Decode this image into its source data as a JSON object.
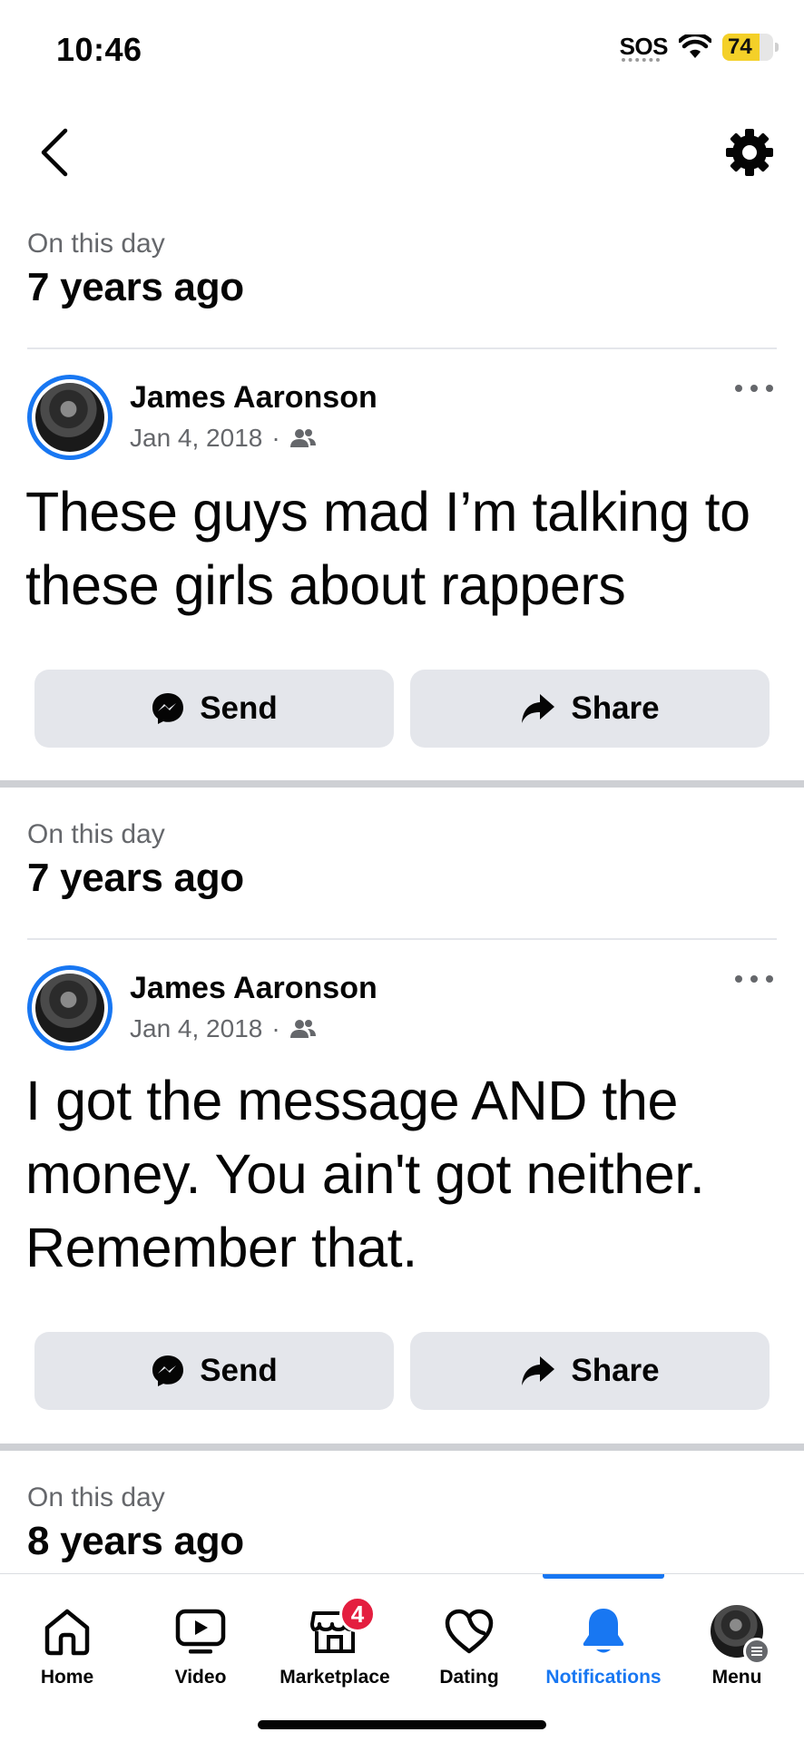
{
  "status_bar": {
    "time": "10:46",
    "sos": "SOS",
    "battery": "74",
    "battery_level": 0.74
  },
  "nav": {
    "back_icon": "chevron-left-icon",
    "settings_icon": "gear-icon"
  },
  "memories": [
    {
      "kicker": "On this day",
      "years": "7 years ago",
      "author": "James Aaronson",
      "date": "Jan 4, 2018",
      "separator": "·",
      "audience_icon": "friends-icon",
      "text": "These guys mad I’m talking to these girls about rappers",
      "send_label": "Send",
      "share_label": "Share"
    },
    {
      "kicker": "On this day",
      "years": "7 years ago",
      "author": "James Aaronson",
      "date": "Jan 4, 2018",
      "separator": "·",
      "audience_icon": "friends-icon",
      "text": "I got the message AND the money. You ain't got neither. Remember that.",
      "send_label": "Send",
      "share_label": "Share"
    },
    {
      "kicker": "On this day",
      "years": "8 years ago"
    }
  ],
  "tabs": [
    {
      "label": "Home",
      "icon": "home-icon",
      "active": false
    },
    {
      "label": "Video",
      "icon": "video-icon",
      "active": false
    },
    {
      "label": "Marketplace",
      "icon": "marketplace-icon",
      "active": false,
      "badge": "4"
    },
    {
      "label": "Dating",
      "icon": "dating-heart-icon",
      "active": false
    },
    {
      "label": "Notifications",
      "icon": "bell-icon",
      "active": true
    },
    {
      "label": "Menu",
      "icon": "profile-avatar",
      "active": false
    }
  ],
  "colors": {
    "accent": "#1877f2",
    "badge": "#e41e3f",
    "button_bg": "#e4e6eb",
    "secondary_text": "#65676b",
    "battery": "#f4d028"
  }
}
